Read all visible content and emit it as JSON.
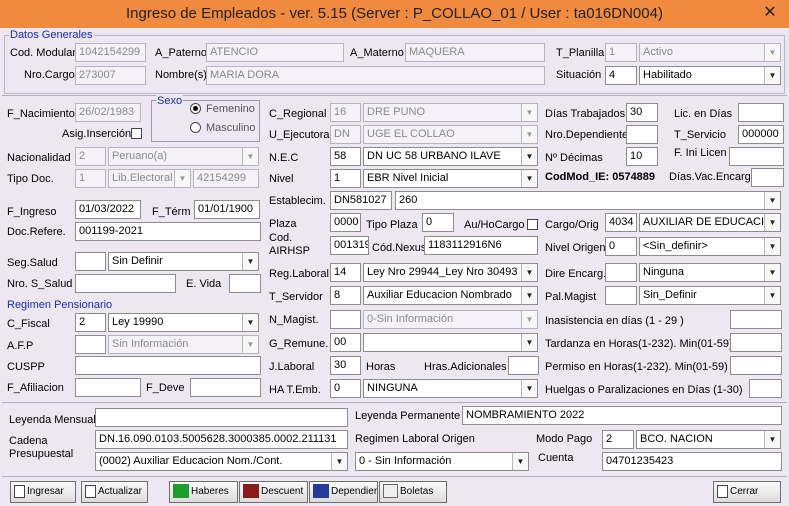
{
  "window": {
    "title": "Ingreso de Empleados - ver. 5.15 (Server : P_COLLAO_01 / User : ta016DN004)",
    "close": "✕"
  },
  "sections": {
    "datos_generales": "Datos Generales",
    "regimen_pensionario": "Regimen Pensionario"
  },
  "labels": {
    "cod_modular": "Cod. Modular",
    "a_paterno": "A_Paterno",
    "a_materno": "A_Materno",
    "t_planilla": "T_Planilla",
    "nro_cargo": "Nro.Cargo",
    "nombres": "Nombre(s)",
    "situacion": "Situación",
    "f_nacimiento": "F_Nacimiento",
    "sexo": "Sexo",
    "femenino": "Femenino",
    "masculino": "Masculino",
    "asig_insercion": "Asig.Inserción",
    "c_regional": "C_Regional",
    "u_ejecutora": "U_Ejecutora",
    "dias_trabajados": "Días Trabajados",
    "nro_dependiente": "Nro.Dependiente",
    "lic_en_dias": "Lic. en Días",
    "t_servicio": "T_Servicio",
    "nacionalidad": "Nacionalidad",
    "nec": "N.E.C",
    "n_decimas": "Nº Décimas",
    "f_ini_licen": "F. Ini Licen",
    "tipo_doc": "Tipo Doc.",
    "nivel": "Nivel",
    "codmod_ie": "CodMod_IE: 0574889",
    "dias_vac": "Días.Vac.Encarg",
    "establecim": "Establecim.",
    "f_ingreso": "F_Ingreso",
    "f_term": "F_Térm",
    "doc_refere": "Doc.Refere.",
    "plaza": "Plaza",
    "tipo_plaza": "Tipo Plaza",
    "au_hocargo": "Au/HoCargo",
    "cargo_orig": "Cargo/Orig",
    "cod_airhsp": "Cod. AIRHSP",
    "cod_nexus": "Cód.Nexus",
    "nivel_origen": "Nivel Origen",
    "seg_salud": "Seg.Salud",
    "nro_s_salud": "Nro. S_Salud",
    "e_vida": "E. Vida",
    "reg_laboral": "Reg.Laboral",
    "dire_encarg": "Dire Encarg.",
    "t_servidor": "T_Servidor",
    "pal_magist": "Pal.Magist",
    "c_fiscal": "C_Fiscal",
    "n_magist": "N_Magist.",
    "inasistencia": "Inasistencia en días (1 - 29 )",
    "afp": "A.F.P",
    "g_remune": "G_Remune.",
    "tardanza": "Tardanza en Horas(1-232). Min(01-59)",
    "cuspp": "CUSPP",
    "j_laboral": "J.Laboral",
    "horas": "Horas",
    "hras_adicionales": "Hras.Adicionales",
    "permiso": "Permiso en Horas(1-232). Min(01-59)",
    "f_afiliacion": "F_Afiliacion",
    "f_deve": "F_Deve",
    "ha_t_emb": "HA T.Emb.",
    "huelgas": "Huelgas o Paralizaciones en Días (1-30)",
    "leyenda_mensual": "Leyenda Mensual",
    "leyenda_permanente": "Leyenda Permanente",
    "cadena_presupuestal": "Cadena\nPresupuestal",
    "regimen_laboral_origen": "Regimen Laboral Origen",
    "modo_pago": "Modo Pago",
    "cuenta": "Cuenta"
  },
  "values": {
    "cod_modular": "1042154299",
    "a_paterno": "ATENCIO",
    "a_materno": "MAQUERA",
    "t_planilla_code": "1",
    "t_planilla": "Activo",
    "nro_cargo": "273007",
    "nombres": "MARIA DORA",
    "situacion_code": "4",
    "situacion": "Habilitado",
    "f_nacimiento": "26/02/1983",
    "c_regional_code": "16",
    "c_regional": "DRE PUNO",
    "u_ejecutora_code": "DN",
    "u_ejecutora": "UGE EL COLLAO",
    "dias_trabajados": "30",
    "nro_dependiente": "",
    "lic_en_dias": "",
    "t_servicio": "000000",
    "nacionalidad_code": "2",
    "nacionalidad": "Peruano(a)",
    "nec_code": "58",
    "nec": "DN UC 58  URBANO ILAVE",
    "n_decimas": "10",
    "f_ini_licen": "",
    "tipo_doc_code": "1",
    "tipo_doc": "Lib.Electoral",
    "num_doc": "42154299",
    "nivel_code": "1",
    "nivel": "EBR Nivel Inicial",
    "dias_vac": "",
    "establecim_code": "DN581027",
    "establecim": "260",
    "f_ingreso": "01/03/2022",
    "f_term": "01/01/1900",
    "doc_refere": "001199-2021",
    "plaza": "0000",
    "tipo_plaza": "0",
    "cargo_code": "4034",
    "cargo": "AUXILIAR DE EDUCACIO",
    "cod_airhsp": "001319",
    "cod_nexus": "1183112916N6",
    "nivel_origen_code": "0",
    "nivel_origen": "<Sin_definir>",
    "seg_salud_code": "",
    "seg_salud": "Sin Definir",
    "nro_s_salud": "",
    "e_vida": "",
    "reg_laboral_code": "14",
    "reg_laboral": "Ley Nro 29944_Ley Nro 30493",
    "dire_encarg_code": "",
    "dire_encarg": "Ninguna",
    "t_servidor_code": "8",
    "t_servidor": "Auxiliar Educacion Nombrado",
    "pal_magist_code": "",
    "pal_magist": "Sin_Definir",
    "c_fiscal_code": "2",
    "c_fiscal": "Ley 19990",
    "n_magist_code": "",
    "n_magist": "0-Sin Información",
    "inasistencia": "",
    "afp_code": "",
    "afp": "Sin Información",
    "g_remune_code": "00",
    "g_remune": "",
    "tardanza": "",
    "cuspp": "",
    "j_laboral": "30",
    "hras_adicionales": "",
    "permiso": "",
    "f_afiliacion": "",
    "f_deve": "",
    "ha_t_emb_code": "0",
    "ha_t_emb": "NINGUNA",
    "huelgas": "",
    "leyenda_mensual": "",
    "leyenda_permanente": "NOMBRAMIENTO 2022",
    "cadena_presupuestal": "DN.16.090.0103.5005628.3000385.0002.211131",
    "cadena_combo": "(0002) Auxiliar Educacion Nom./Cont.",
    "regimen_laboral_origen": "0 - Sin Información",
    "modo_pago_code": "2",
    "modo_pago": "BCO. NACION",
    "cuenta": "04701235423"
  },
  "buttons": {
    "ingresar": "Ingresar",
    "actualizar": "Actualizar",
    "haberes": "Haberes",
    "descuent": "Descuent",
    "dependient": "Dependient",
    "boletas": "Boletas",
    "cerrar": "Cerrar"
  },
  "icons": {
    "arrow": "▼"
  }
}
